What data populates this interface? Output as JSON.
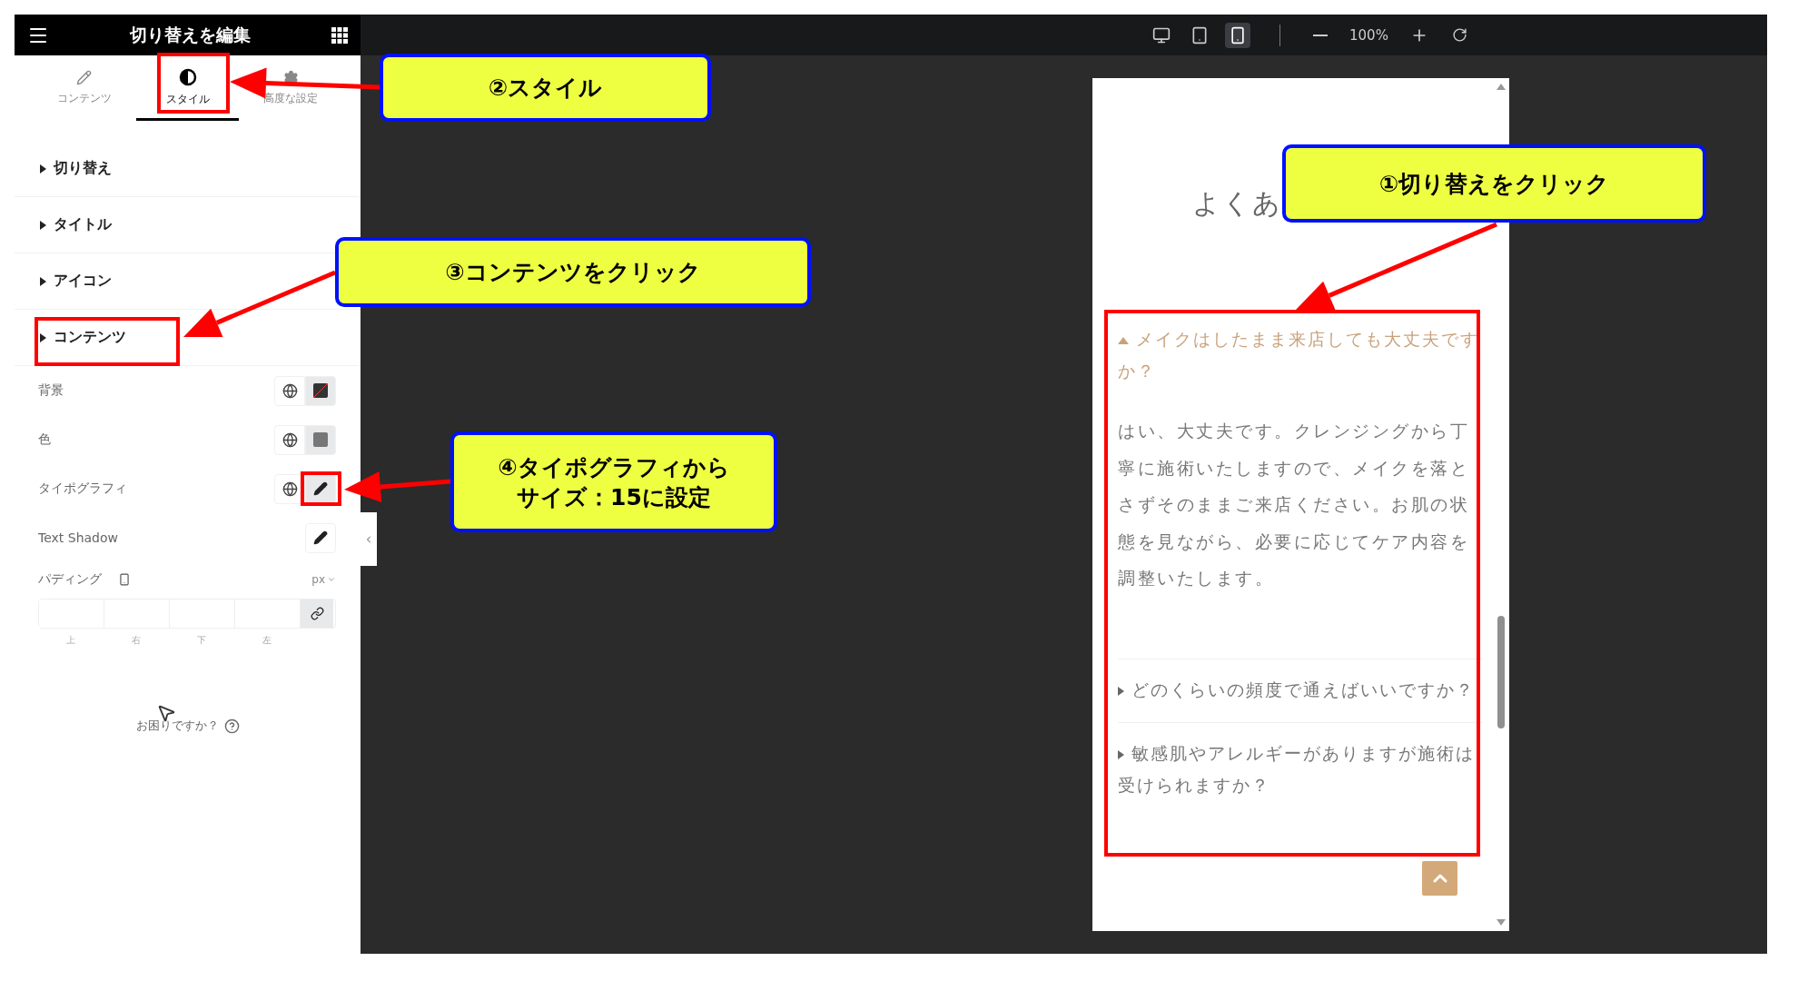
{
  "editor_panel": {
    "title": "切り替えを編集",
    "tabs": [
      {
        "kind": "content",
        "label": "コンテンツ",
        "selected": false
      },
      {
        "kind": "style",
        "label": "スタイル",
        "selected": true
      },
      {
        "kind": "advanced",
        "label": "高度な設定",
        "selected": false
      }
    ],
    "sections": [
      {
        "label": "切り替え"
      },
      {
        "label": "タイトル"
      },
      {
        "label": "アイコン"
      },
      {
        "label": "コンテンツ"
      }
    ],
    "controls": [
      {
        "kind": "color",
        "label": "背景",
        "cleared": true
      },
      {
        "kind": "color",
        "label": "色",
        "cleared": false
      },
      {
        "kind": "popover",
        "label": "タイポグラフィ",
        "global": true
      },
      {
        "kind": "popover",
        "label": "Text Shadow",
        "global": false
      },
      {
        "kind": "dimensions",
        "label": "パディング",
        "unit": "px",
        "sides": [
          "上",
          "右",
          "下",
          "左"
        ]
      }
    ],
    "help": "お困りですか？"
  },
  "toolbar": {
    "devices": [
      {
        "kind": "desktop",
        "selected": false
      },
      {
        "kind": "tablet",
        "selected": false
      },
      {
        "kind": "mobile",
        "selected": true
      }
    ],
    "zoom": "100%"
  },
  "preview": {
    "heading": "よくあ",
    "faq": [
      {
        "question": "メイクはしたまま来店しても大丈夫ですか？",
        "expanded": true,
        "answer": "はい、大丈夫です。クレンジングから丁寧に施術いたしますので、メイクを落とさずそのままご来店ください。お肌の状態を見ながら、必要に応じてケア内容を調整いたします。"
      },
      {
        "question": "どのくらいの頻度で通えばいいですか？",
        "expanded": false
      },
      {
        "question": "敏感肌やアレルギーがありますが施術は受けられますか？",
        "expanded": false
      }
    ]
  },
  "annotations": [
    {
      "lines": [
        "②スタイル"
      ]
    },
    {
      "lines": [
        "①切り替えをクリック"
      ]
    },
    {
      "lines": [
        "③コンテンツをクリック"
      ]
    },
    {
      "lines": [
        "④タイポグラフィから",
        "サイズ：15に設定"
      ]
    }
  ]
}
